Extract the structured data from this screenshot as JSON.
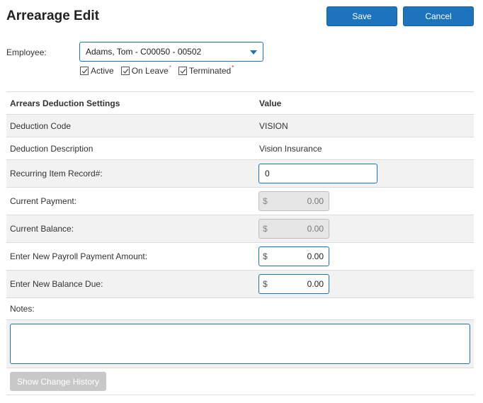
{
  "page": {
    "title": "Arrearage Edit",
    "save_label": "Save",
    "cancel_label": "Cancel"
  },
  "employee": {
    "label": "Employee:",
    "selected": "Adams, Tom  - C00050 - 00502",
    "filters": [
      {
        "label": "Active",
        "checked": true,
        "marker": ""
      },
      {
        "label": "On Leave",
        "checked": true,
        "marker": "*"
      },
      {
        "label": "Terminated",
        "checked": true,
        "marker": "*"
      }
    ]
  },
  "settings": {
    "header_label": "Arrears Deduction Settings",
    "header_value": "Value",
    "deduction_code_label": "Deduction Code",
    "deduction_code_value": "VISION",
    "deduction_desc_label": "Deduction Description",
    "deduction_desc_value": "Vision Insurance",
    "recurring_label": "Recurring Item Record#:",
    "recurring_value": "0",
    "current_payment_label": "Current Payment:",
    "current_payment_value": "0.00",
    "current_balance_label": "Current Balance:",
    "current_balance_value": "0.00",
    "new_payment_label": "Enter New Payroll Payment Amount:",
    "new_payment_value": "0.00",
    "new_balance_label": "Enter New Balance Due:",
    "new_balance_value": "0.00",
    "currency_symbol": "$",
    "notes_label": "Notes:",
    "notes_value": ""
  },
  "history": {
    "button_label": "Show Change History"
  },
  "colors": {
    "primary": "#1b74bd",
    "row_alt": "#f2f2f2",
    "asterisk": "#e01010"
  }
}
